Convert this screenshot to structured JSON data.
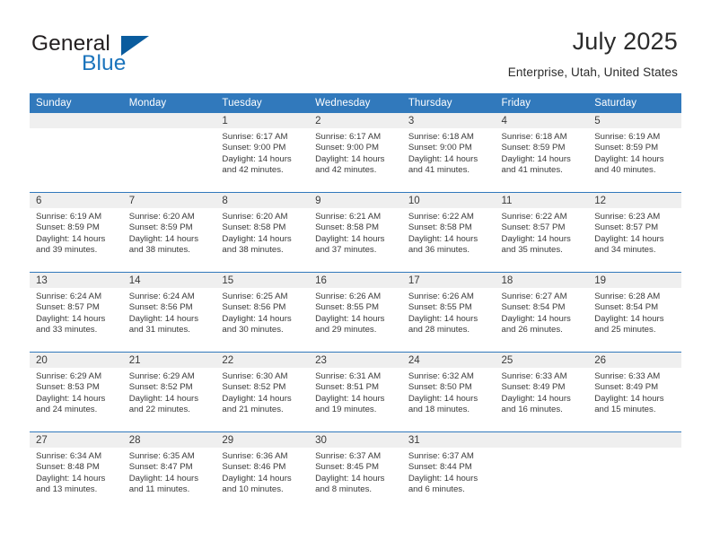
{
  "brand": {
    "word_one": "General",
    "word_two": "Blue",
    "logo_icon": "triangle-logo-icon",
    "accent_color": "#1b74bc"
  },
  "header": {
    "month_title": "July 2025",
    "location": "Enterprise, Utah, United States"
  },
  "colors": {
    "header_blue": "#3179bc",
    "day_band_gray": "#efefef",
    "text": "#3a3a3a"
  },
  "weekday_headers": [
    "Sunday",
    "Monday",
    "Tuesday",
    "Wednesday",
    "Thursday",
    "Friday",
    "Saturday"
  ],
  "labels": {
    "sunrise_prefix": "Sunrise:",
    "sunset_prefix": "Sunset:",
    "daylight_prefix": "Daylight:"
  },
  "weeks": [
    [
      {
        "day": "",
        "sunrise": "",
        "sunset": "",
        "daylight_line1": "",
        "daylight_line2": ""
      },
      {
        "day": "",
        "sunrise": "",
        "sunset": "",
        "daylight_line1": "",
        "daylight_line2": ""
      },
      {
        "day": "1",
        "sunrise": "Sunrise: 6:17 AM",
        "sunset": "Sunset: 9:00 PM",
        "daylight_line1": "Daylight: 14 hours",
        "daylight_line2": "and 42 minutes."
      },
      {
        "day": "2",
        "sunrise": "Sunrise: 6:17 AM",
        "sunset": "Sunset: 9:00 PM",
        "daylight_line1": "Daylight: 14 hours",
        "daylight_line2": "and 42 minutes."
      },
      {
        "day": "3",
        "sunrise": "Sunrise: 6:18 AM",
        "sunset": "Sunset: 9:00 PM",
        "daylight_line1": "Daylight: 14 hours",
        "daylight_line2": "and 41 minutes."
      },
      {
        "day": "4",
        "sunrise": "Sunrise: 6:18 AM",
        "sunset": "Sunset: 8:59 PM",
        "daylight_line1": "Daylight: 14 hours",
        "daylight_line2": "and 41 minutes."
      },
      {
        "day": "5",
        "sunrise": "Sunrise: 6:19 AM",
        "sunset": "Sunset: 8:59 PM",
        "daylight_line1": "Daylight: 14 hours",
        "daylight_line2": "and 40 minutes."
      }
    ],
    [
      {
        "day": "6",
        "sunrise": "Sunrise: 6:19 AM",
        "sunset": "Sunset: 8:59 PM",
        "daylight_line1": "Daylight: 14 hours",
        "daylight_line2": "and 39 minutes."
      },
      {
        "day": "7",
        "sunrise": "Sunrise: 6:20 AM",
        "sunset": "Sunset: 8:59 PM",
        "daylight_line1": "Daylight: 14 hours",
        "daylight_line2": "and 38 minutes."
      },
      {
        "day": "8",
        "sunrise": "Sunrise: 6:20 AM",
        "sunset": "Sunset: 8:58 PM",
        "daylight_line1": "Daylight: 14 hours",
        "daylight_line2": "and 38 minutes."
      },
      {
        "day": "9",
        "sunrise": "Sunrise: 6:21 AM",
        "sunset": "Sunset: 8:58 PM",
        "daylight_line1": "Daylight: 14 hours",
        "daylight_line2": "and 37 minutes."
      },
      {
        "day": "10",
        "sunrise": "Sunrise: 6:22 AM",
        "sunset": "Sunset: 8:58 PM",
        "daylight_line1": "Daylight: 14 hours",
        "daylight_line2": "and 36 minutes."
      },
      {
        "day": "11",
        "sunrise": "Sunrise: 6:22 AM",
        "sunset": "Sunset: 8:57 PM",
        "daylight_line1": "Daylight: 14 hours",
        "daylight_line2": "and 35 minutes."
      },
      {
        "day": "12",
        "sunrise": "Sunrise: 6:23 AM",
        "sunset": "Sunset: 8:57 PM",
        "daylight_line1": "Daylight: 14 hours",
        "daylight_line2": "and 34 minutes."
      }
    ],
    [
      {
        "day": "13",
        "sunrise": "Sunrise: 6:24 AM",
        "sunset": "Sunset: 8:57 PM",
        "daylight_line1": "Daylight: 14 hours",
        "daylight_line2": "and 33 minutes."
      },
      {
        "day": "14",
        "sunrise": "Sunrise: 6:24 AM",
        "sunset": "Sunset: 8:56 PM",
        "daylight_line1": "Daylight: 14 hours",
        "daylight_line2": "and 31 minutes."
      },
      {
        "day": "15",
        "sunrise": "Sunrise: 6:25 AM",
        "sunset": "Sunset: 8:56 PM",
        "daylight_line1": "Daylight: 14 hours",
        "daylight_line2": "and 30 minutes."
      },
      {
        "day": "16",
        "sunrise": "Sunrise: 6:26 AM",
        "sunset": "Sunset: 8:55 PM",
        "daylight_line1": "Daylight: 14 hours",
        "daylight_line2": "and 29 minutes."
      },
      {
        "day": "17",
        "sunrise": "Sunrise: 6:26 AM",
        "sunset": "Sunset: 8:55 PM",
        "daylight_line1": "Daylight: 14 hours",
        "daylight_line2": "and 28 minutes."
      },
      {
        "day": "18",
        "sunrise": "Sunrise: 6:27 AM",
        "sunset": "Sunset: 8:54 PM",
        "daylight_line1": "Daylight: 14 hours",
        "daylight_line2": "and 26 minutes."
      },
      {
        "day": "19",
        "sunrise": "Sunrise: 6:28 AM",
        "sunset": "Sunset: 8:54 PM",
        "daylight_line1": "Daylight: 14 hours",
        "daylight_line2": "and 25 minutes."
      }
    ],
    [
      {
        "day": "20",
        "sunrise": "Sunrise: 6:29 AM",
        "sunset": "Sunset: 8:53 PM",
        "daylight_line1": "Daylight: 14 hours",
        "daylight_line2": "and 24 minutes."
      },
      {
        "day": "21",
        "sunrise": "Sunrise: 6:29 AM",
        "sunset": "Sunset: 8:52 PM",
        "daylight_line1": "Daylight: 14 hours",
        "daylight_line2": "and 22 minutes."
      },
      {
        "day": "22",
        "sunrise": "Sunrise: 6:30 AM",
        "sunset": "Sunset: 8:52 PM",
        "daylight_line1": "Daylight: 14 hours",
        "daylight_line2": "and 21 minutes."
      },
      {
        "day": "23",
        "sunrise": "Sunrise: 6:31 AM",
        "sunset": "Sunset: 8:51 PM",
        "daylight_line1": "Daylight: 14 hours",
        "daylight_line2": "and 19 minutes."
      },
      {
        "day": "24",
        "sunrise": "Sunrise: 6:32 AM",
        "sunset": "Sunset: 8:50 PM",
        "daylight_line1": "Daylight: 14 hours",
        "daylight_line2": "and 18 minutes."
      },
      {
        "day": "25",
        "sunrise": "Sunrise: 6:33 AM",
        "sunset": "Sunset: 8:49 PM",
        "daylight_line1": "Daylight: 14 hours",
        "daylight_line2": "and 16 minutes."
      },
      {
        "day": "26",
        "sunrise": "Sunrise: 6:33 AM",
        "sunset": "Sunset: 8:49 PM",
        "daylight_line1": "Daylight: 14 hours",
        "daylight_line2": "and 15 minutes."
      }
    ],
    [
      {
        "day": "27",
        "sunrise": "Sunrise: 6:34 AM",
        "sunset": "Sunset: 8:48 PM",
        "daylight_line1": "Daylight: 14 hours",
        "daylight_line2": "and 13 minutes."
      },
      {
        "day": "28",
        "sunrise": "Sunrise: 6:35 AM",
        "sunset": "Sunset: 8:47 PM",
        "daylight_line1": "Daylight: 14 hours",
        "daylight_line2": "and 11 minutes."
      },
      {
        "day": "29",
        "sunrise": "Sunrise: 6:36 AM",
        "sunset": "Sunset: 8:46 PM",
        "daylight_line1": "Daylight: 14 hours",
        "daylight_line2": "and 10 minutes."
      },
      {
        "day": "30",
        "sunrise": "Sunrise: 6:37 AM",
        "sunset": "Sunset: 8:45 PM",
        "daylight_line1": "Daylight: 14 hours",
        "daylight_line2": "and 8 minutes."
      },
      {
        "day": "31",
        "sunrise": "Sunrise: 6:37 AM",
        "sunset": "Sunset: 8:44 PM",
        "daylight_line1": "Daylight: 14 hours",
        "daylight_line2": "and 6 minutes."
      },
      {
        "day": "",
        "sunrise": "",
        "sunset": "",
        "daylight_line1": "",
        "daylight_line2": ""
      },
      {
        "day": "",
        "sunrise": "",
        "sunset": "",
        "daylight_line1": "",
        "daylight_line2": ""
      }
    ]
  ]
}
